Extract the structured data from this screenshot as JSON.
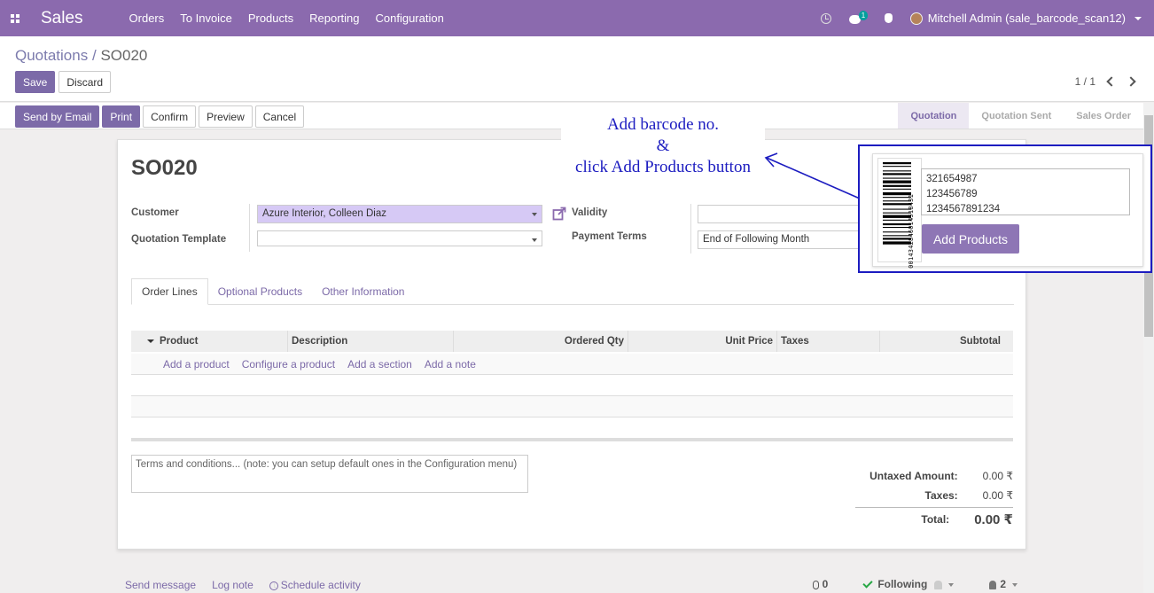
{
  "navbar": {
    "app_name": "Sales",
    "menu": [
      "Orders",
      "To Invoice",
      "Products",
      "Reporting",
      "Configuration"
    ],
    "chat_count": "1",
    "user": "Mitchell Admin (sale_barcode_scan12)"
  },
  "breadcrumb": {
    "parent": "Quotations",
    "separator": "/",
    "current": "SO020"
  },
  "buttons": {
    "save": "Save",
    "discard": "Discard",
    "send_email": "Send by Email",
    "print": "Print",
    "confirm": "Confirm",
    "preview": "Preview",
    "cancel": "Cancel"
  },
  "pager": {
    "value": "1 / 1"
  },
  "stages": [
    "Quotation",
    "Quotation Sent",
    "Sales Order"
  ],
  "form": {
    "title": "SO020",
    "customer_label": "Customer",
    "customer_value": "Azure Interior, Colleen Diaz",
    "template_label": "Quotation Template",
    "template_value": "",
    "validity_label": "Validity",
    "validity_value": "",
    "payment_label": "Payment Terms",
    "payment_value": "End of Following Month"
  },
  "tabs": [
    "Order Lines",
    "Optional Products",
    "Other Information"
  ],
  "table": {
    "columns": [
      "Product",
      "Description",
      "Ordered Qty",
      "Unit Price",
      "Taxes",
      "Subtotal"
    ],
    "add_links": [
      "Add a product",
      "Configure a product",
      "Add a section",
      "Add a note"
    ]
  },
  "terms_placeholder": "Terms and conditions... (note: you can setup default ones in the Configuration menu)",
  "totals": {
    "untaxed_label": "Untaxed Amount:",
    "untaxed_value": "0.00 ₹",
    "taxes_label": "Taxes:",
    "taxes_value": "0.00 ₹",
    "total_label": "Total:",
    "total_value": "0.00 ₹"
  },
  "chatter": {
    "send_message": "Send message",
    "log_note": "Log note",
    "schedule": "Schedule activity",
    "attachments": "0",
    "following": "Following",
    "followers": "2"
  },
  "annotation": {
    "line1": "Add  barcode  no.",
    "line2": "&",
    "line3": "click  Add  Products  button"
  },
  "barcode_panel": {
    "barcode_number": "0014342846014518431",
    "textarea_value": "321654987\n123456789\n1234567891234",
    "button_label": "Add Products"
  },
  "colors": {
    "brand": "#8b6aae",
    "primary_button": "#7c6aa8",
    "annotation": "#1c1cc0"
  }
}
